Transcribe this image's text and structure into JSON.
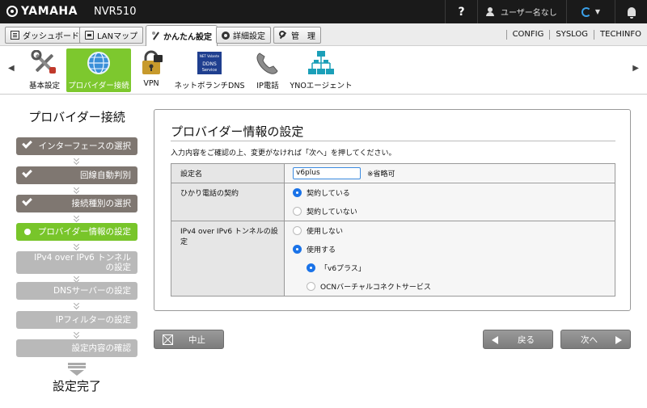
{
  "header": {
    "brand": "YAMAHA",
    "model": "NVR510",
    "help": "?",
    "user_name": "ユーザー名なし"
  },
  "nav": {
    "tabs": [
      {
        "label": "ダッシュボード",
        "icon": "dashboard-icon"
      },
      {
        "label": "LANマップ",
        "icon": "lan-map-icon"
      },
      {
        "label": "かんたん設定",
        "icon": "wizard-icon",
        "active": true
      },
      {
        "label": "詳細設定",
        "icon": "gear-icon"
      },
      {
        "label": "管　理",
        "icon": "wrench-icon"
      }
    ],
    "links": [
      "CONFIG",
      "SYSLOG",
      "TECHINFO"
    ]
  },
  "toolbar": {
    "items": [
      {
        "label": "基本設定",
        "icon": "tools-icon"
      },
      {
        "label": "プロバイダー接続",
        "icon": "globe-icon",
        "active": true
      },
      {
        "label": "VPN",
        "icon": "lock-icon"
      },
      {
        "label": "ネットボランチDNS",
        "icon": "netvolante-dns-icon",
        "badge_top": "NET Volante",
        "badge_mid": "DDNS",
        "badge_bot": "Service"
      },
      {
        "label": "IP電話",
        "icon": "phone-icon"
      },
      {
        "label": "YNOエージェント",
        "icon": "yno-network-icon"
      }
    ]
  },
  "wizard": {
    "title": "プロバイダー接続",
    "steps": [
      {
        "label": "インターフェースの選択",
        "state": "done"
      },
      {
        "label": "回線自動判別",
        "state": "done"
      },
      {
        "label": "接続種別の選択",
        "state": "done"
      },
      {
        "label": "プロバイダー情報の設定",
        "state": "current"
      },
      {
        "label": "IPv4 over IPv6 トンネルの設定",
        "line1": "IPv4 over IPv6 トンネル",
        "line2": "の設定",
        "state": "todo"
      },
      {
        "label": "DNSサーバーの設定",
        "state": "todo"
      },
      {
        "label": "IPフィルターの設定",
        "state": "todo"
      },
      {
        "label": "設定内容の確認",
        "state": "todo"
      }
    ],
    "finish": "設定完了"
  },
  "form": {
    "title": "プロバイダー情報の設定",
    "description": "入力内容をご確認の上、変更がなければ「次へ」を押してください。",
    "setting_name": {
      "label": "設定名",
      "value": "v6plus",
      "note": "※省略可"
    },
    "hikari_phone": {
      "label": "ひかり電話の契約",
      "options": [
        {
          "label": "契約している",
          "checked": true
        },
        {
          "label": "契約していない",
          "checked": false
        }
      ]
    },
    "tunnel": {
      "label": "IPv4 over IPv6 トンネルの設定",
      "options": [
        {
          "label": "使用しない",
          "checked": false
        },
        {
          "label": "使用する",
          "checked": true
        }
      ],
      "sub_options": [
        {
          "label": "「v6プラス」",
          "checked": true
        },
        {
          "label": "OCNバーチャルコネクトサービス",
          "checked": false
        }
      ]
    }
  },
  "buttons": {
    "cancel": "中止",
    "back": "戻る",
    "next": "次へ"
  },
  "colors": {
    "accent_green": "#78c52a",
    "done_step": "#7f7771",
    "todo_step": "#b9b9b9",
    "radio_blue": "#1a73e8"
  }
}
